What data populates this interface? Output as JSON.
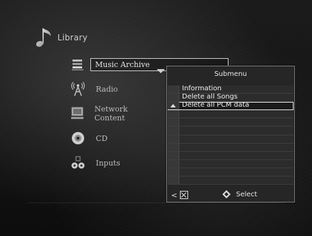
{
  "header": {
    "title": "Library",
    "icon": "music-note-icon"
  },
  "menu": {
    "items": [
      {
        "label": "Music Archive",
        "icon": "music-archive-icon",
        "selected": true
      },
      {
        "label": "Radio",
        "icon": "radio-tower-icon"
      },
      {
        "label": "Network Content",
        "icon": "network-computer-icon"
      },
      {
        "label": "CD",
        "icon": "cd-disc-icon"
      },
      {
        "label": "Inputs",
        "icon": "inputs-icon"
      }
    ]
  },
  "submenu": {
    "title": "Submenu",
    "items": [
      {
        "label": "Information"
      },
      {
        "label": "Delete all Songs"
      },
      {
        "label": "Delete all PCM data",
        "selected": true
      }
    ],
    "footer": {
      "back": "<",
      "cancel_icon": "cancel-box-icon",
      "select_icon": "nav-diamond-icon",
      "select_label": "Select"
    }
  },
  "colors": {
    "background": "#0d0d0d",
    "submenu_bg": "#262626",
    "text": "#e8e8e8"
  }
}
